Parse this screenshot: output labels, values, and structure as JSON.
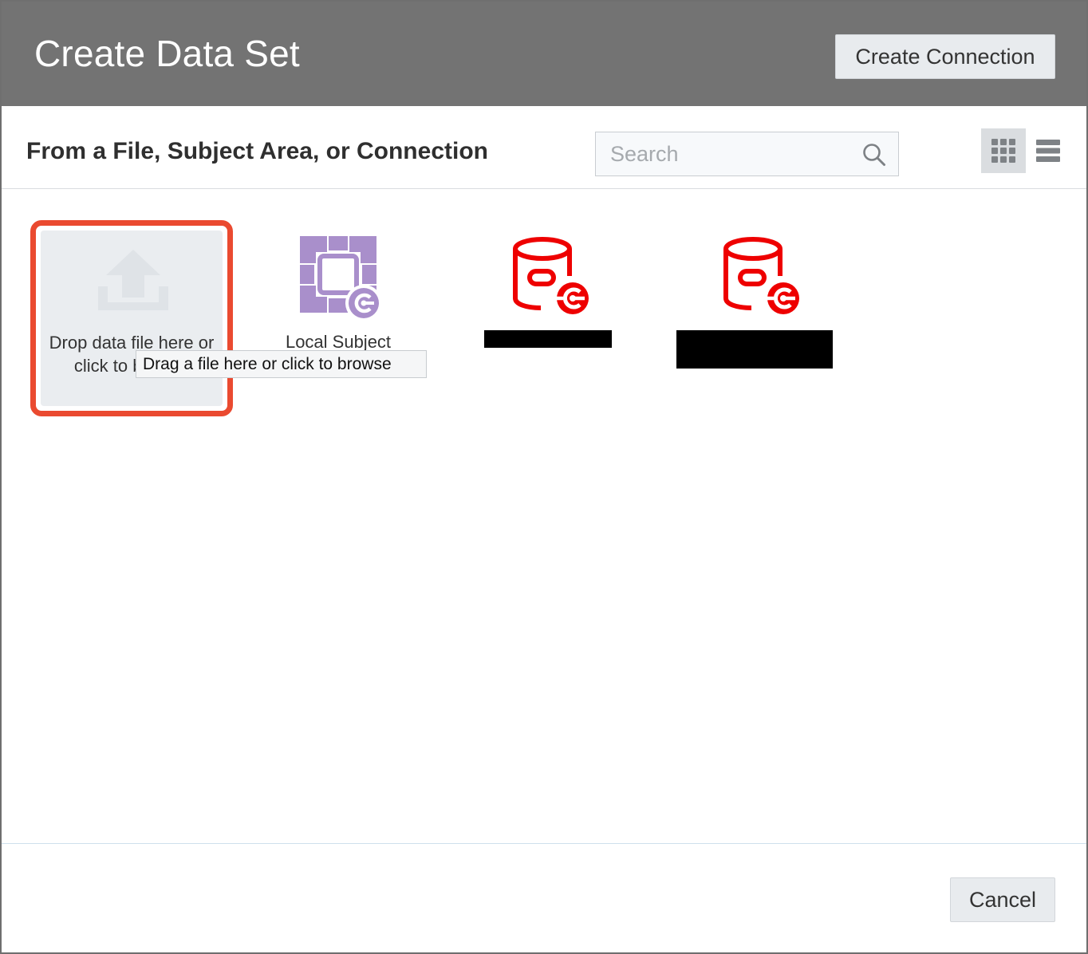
{
  "dialog": {
    "title": "Create Data Set",
    "create_connection_label": "Create Connection",
    "cancel_label": "Cancel"
  },
  "subheader": {
    "title": "From a File, Subject Area, or Connection",
    "search_placeholder": "Search",
    "search_icon": "search-icon",
    "view_modes": [
      "grid-view-icon",
      "list-view-icon"
    ]
  },
  "tiles": {
    "drop": {
      "label": "Drop data file here or click to browse",
      "icon": "upload-icon"
    },
    "local_subject_area": {
      "label": "Local Subject",
      "icon": "subject-area-icon"
    },
    "connection_1": {
      "icon": "database-connection-icon"
    },
    "connection_2": {
      "icon": "database-connection-icon"
    }
  },
  "tooltip": {
    "text": "Drag a file here or click to browse"
  },
  "colors": {
    "header_bg": "#737373",
    "highlight_border": "#ea4a30",
    "subject_area_purple": "#a98fcb",
    "connection_red": "#ee0000"
  }
}
